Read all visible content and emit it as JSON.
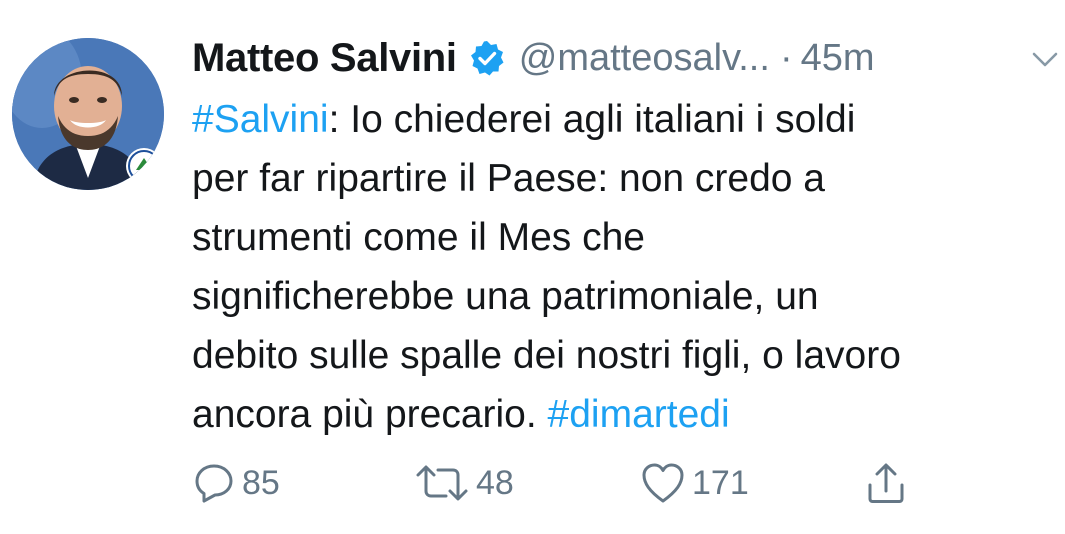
{
  "user": {
    "display_name": "Matteo Salvini",
    "handle": "@matteosalv...",
    "separator": "·",
    "time": "45m",
    "verified": true
  },
  "tweet": {
    "lines": [
      {
        "hashtag": "#Salvini",
        "text": ": Io chiederei agli italiani i soldi"
      },
      {
        "text": "per far ripartire il Paese: non credo a"
      },
      {
        "text": "strumenti come il Mes che"
      },
      {
        "text": "significherebbe una patrimoniale, un"
      },
      {
        "text": "debito sulle spalle dei nostri figli, o lavoro"
      },
      {
        "text": "ancora più precario. ",
        "hashtag": "#dimartedi"
      }
    ]
  },
  "actions": {
    "reply": {
      "icon": "reply-icon",
      "count": "85"
    },
    "retweet": {
      "icon": "retweet-icon",
      "count": "48"
    },
    "like": {
      "icon": "heart-icon",
      "count": "171"
    },
    "share": {
      "icon": "share-icon"
    }
  },
  "colors": {
    "text": "#14171a",
    "muted": "#657786",
    "link": "#1da1f2",
    "verified": "#1da1f2"
  }
}
